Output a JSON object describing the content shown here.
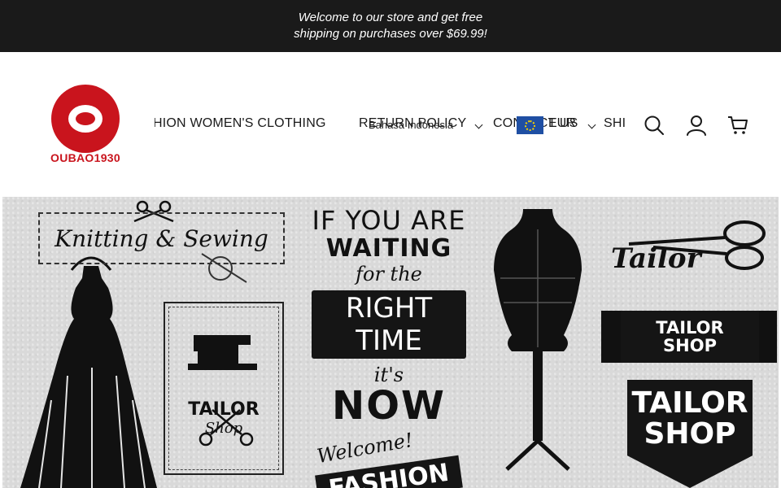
{
  "announcement": {
    "line1": "Welcome to our store and get free",
    "line2": "shipping on purchases over $69.99!"
  },
  "brand": {
    "logo_text": "OUBAO1930",
    "brand_color": "#c9141d"
  },
  "nav": {
    "items": [
      {
        "label": "HION WOMEN'S CLOTHING",
        "has_dropdown": false
      },
      {
        "label": "RETURN POLICY",
        "has_dropdown": true
      },
      {
        "label": "CONTACT US",
        "has_dropdown": true
      },
      {
        "label": "SHI",
        "has_dropdown": false
      }
    ],
    "language_overlay": "Bahasa Indonesia",
    "currency_overlay": "EUR",
    "flag_icon": "eu-flag-icon"
  },
  "header_icons": {
    "search": "search-icon",
    "account": "account-icon",
    "cart": "cart-icon"
  },
  "hero": {
    "knitting_title": "Knitting & Sewing",
    "tailor_box_title": "TAILOR",
    "tailor_box_sub": "Shop",
    "wait_line1": "IF YOU ARE",
    "wait_line2": "WAITING",
    "wait_line3": "for the",
    "wait_line4": "RIGHT TIME",
    "wait_line5": "it's",
    "wait_line6": "NOW",
    "welcome": "Welcome!",
    "fashion": "FASHION",
    "tailor_script": "Tailor",
    "spool_line1": "TAILOR",
    "spool_line2": "SHOP",
    "shield_line1": "TAILOR",
    "shield_line2": "SHOP"
  },
  "colors": {
    "announcement_bg": "#1a1a1a",
    "hero_bg": "#d9d9d9"
  }
}
